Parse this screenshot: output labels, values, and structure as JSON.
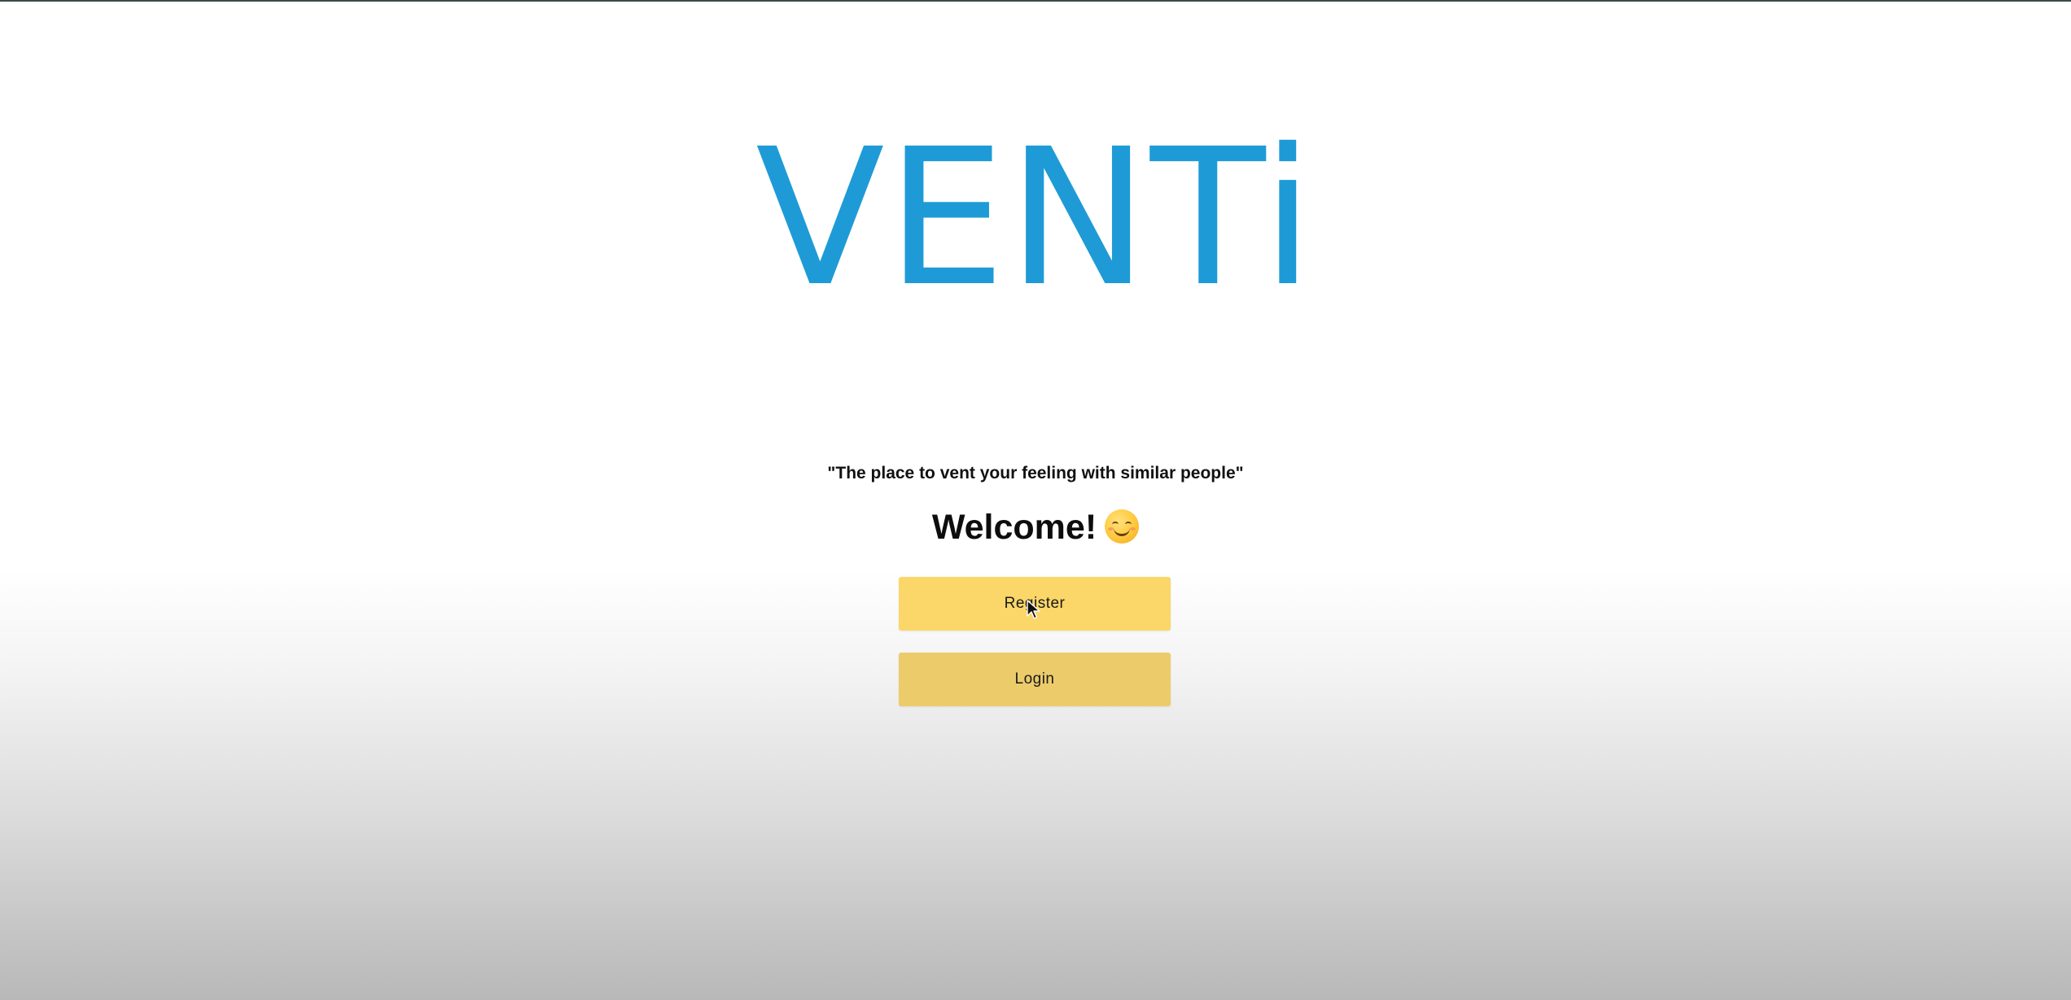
{
  "logo": {
    "text": "VENTi",
    "color": "#1e9bd7"
  },
  "tagline": "\"The place to vent your feeling with similar people\"",
  "welcome": {
    "text": "Welcome!",
    "emoji_icon": "smiling-face-icon"
  },
  "buttons": {
    "register_label": "Register",
    "login_label": "Login",
    "register_color": "#fbd669",
    "login_color": "#eccb6a"
  }
}
